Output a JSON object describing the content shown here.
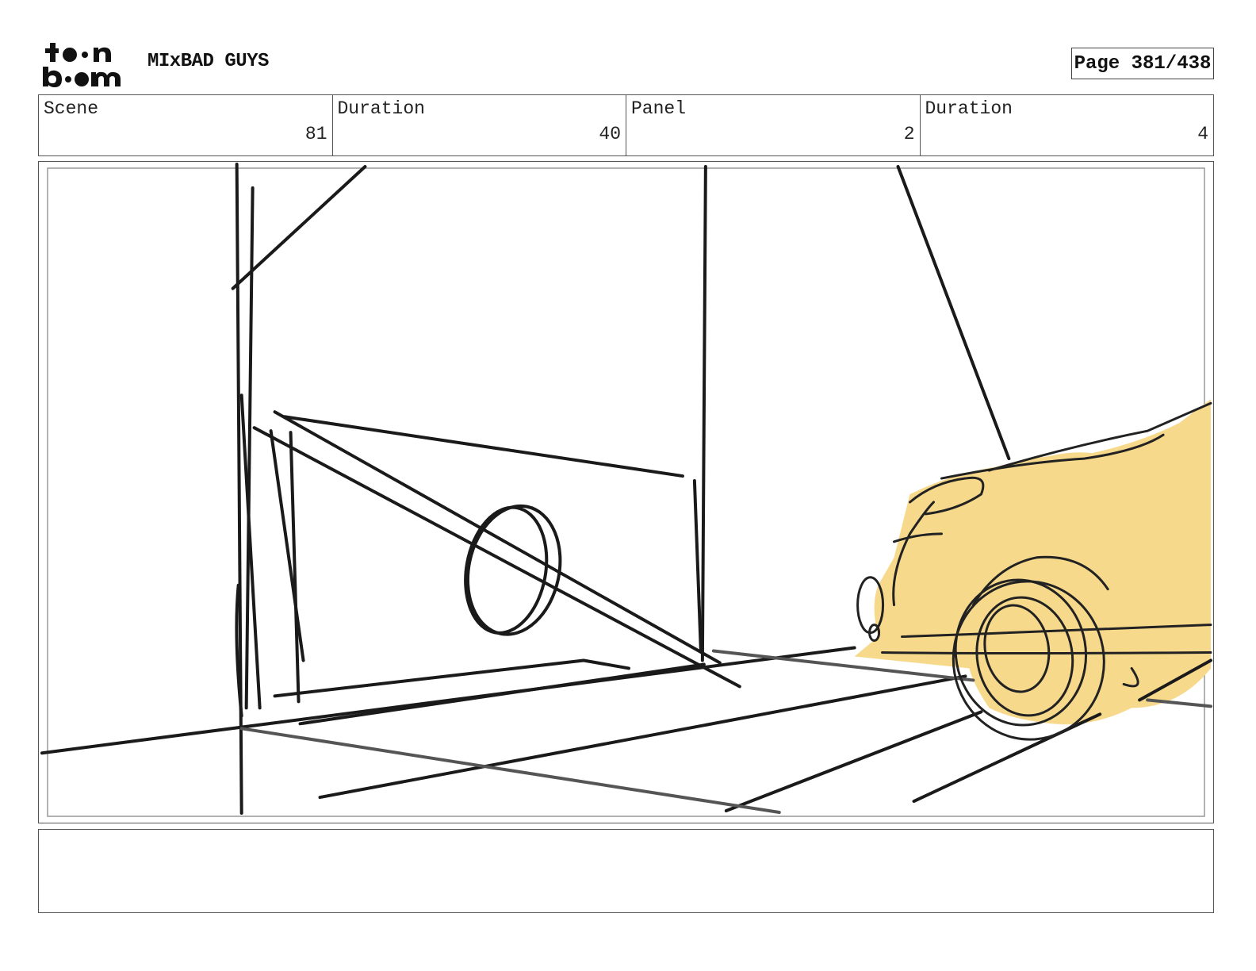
{
  "header": {
    "logo_text": "toon boom",
    "project_title": "MIxBAD GUYS",
    "page_label": "Page 381/438"
  },
  "info": {
    "scene_label": "Scene",
    "scene_value": "81",
    "scene_duration_label": "Duration",
    "scene_duration_value": "40",
    "panel_label": "Panel",
    "panel_value": "2",
    "panel_duration_label": "Duration",
    "panel_duration_value": "4"
  },
  "colors": {
    "car_fill": "#f7d98c",
    "sketch_line": "#1a1a1a"
  }
}
